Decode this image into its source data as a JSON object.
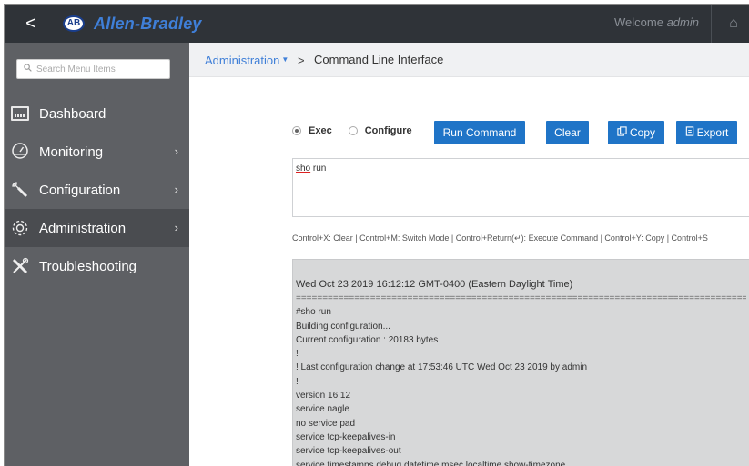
{
  "topbar": {
    "back": "<",
    "logo_badge": "AB",
    "brand": "Allen-Bradley",
    "welcome_prefix": "Welcome",
    "welcome_user": "admin",
    "home": "⌂"
  },
  "sidebar": {
    "search_placeholder": "Search Menu Items",
    "items": [
      {
        "label": "Dashboard",
        "icon": "dashboard-icon",
        "chevron": ""
      },
      {
        "label": "Monitoring",
        "icon": "gauge-icon",
        "chevron": "›"
      },
      {
        "label": "Configuration",
        "icon": "wrench-icon",
        "chevron": "›"
      },
      {
        "label": "Administration",
        "icon": "gear-icon",
        "chevron": "›"
      },
      {
        "label": "Troubleshooting",
        "icon": "tools-icon",
        "chevron": ""
      }
    ]
  },
  "breadcrumb": {
    "parent": "Administration",
    "caret": "▼",
    "separator": ">",
    "current": "Command Line Interface"
  },
  "cli": {
    "modes": [
      {
        "label": "Exec",
        "selected": true
      },
      {
        "label": "Configure",
        "selected": false
      }
    ],
    "buttons": {
      "run": "Run Command",
      "clear": "Clear",
      "copy": "Copy",
      "export": "Export"
    },
    "command_word": "sho",
    "command_rest": " run",
    "shortcuts": "Control+X: Clear | Control+M: Switch Mode | Control+Return(↵): Execute Command | Control+Y: Copy | Control+S",
    "output_date": "Wed Oct 23 2019 16:12:12 GMT-0400 (Eastern Daylight Time)",
    "output_rule": "==================================================================================================",
    "output_lines": [
      "#sho run",
      "Building configuration...",
      "Current configuration : 20183 bytes",
      "!",
      "! Last configuration change at 17:53:46 UTC Wed Oct 23 2019 by admin",
      "!",
      "version 16.12",
      "service nagle",
      "no service pad",
      "service tcp-keepalives-in",
      "service tcp-keepalives-out",
      "service timestamps debug datetime msec localtime show-timezone"
    ]
  },
  "colors": {
    "topbar": "#2f3338",
    "sidebar": "#5e6064",
    "sidebar_active": "#4a4c50",
    "accent": "#1f74c7",
    "brand": "#3f7fd8",
    "output_bg": "#d7d8d9"
  }
}
